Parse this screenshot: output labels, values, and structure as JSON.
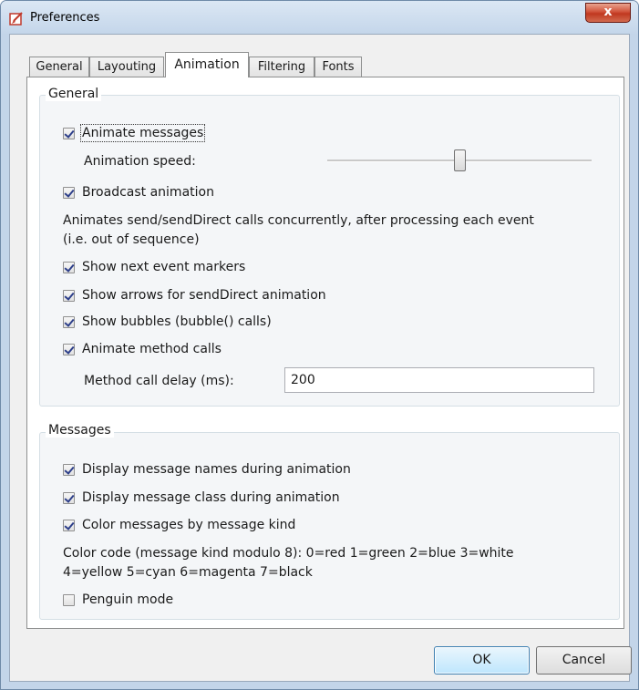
{
  "window": {
    "title": "Preferences",
    "close_glyph": "x"
  },
  "tabs": [
    {
      "label": "General"
    },
    {
      "label": "Layouting"
    },
    {
      "label": "Animation"
    },
    {
      "label": "Filtering"
    },
    {
      "label": "Fonts"
    }
  ],
  "general": {
    "title": "General",
    "animate_messages": {
      "label": "Animate messages",
      "checked": true
    },
    "animation_speed_label": "Animation speed:",
    "animation_speed_level": 0.52,
    "broadcast_animation": {
      "label": "Broadcast animation",
      "checked": true
    },
    "broadcast_description_line1": "Animates send/sendDirect calls concurrently, after processing each event",
    "broadcast_description_line2": "(i.e. out of sequence)",
    "show_next_event_markers": {
      "label": "Show next event markers",
      "checked": true
    },
    "show_arrows": {
      "label": "Show arrows for sendDirect animation",
      "checked": true
    },
    "show_bubbles": {
      "label": "Show bubbles (bubble() calls)",
      "checked": true
    },
    "animate_method_calls": {
      "label": "Animate method calls",
      "checked": true
    },
    "method_call_delay_label": "Method call delay (ms):",
    "method_call_delay_value": "200"
  },
  "messages": {
    "title": "Messages",
    "display_names": {
      "label": "Display message names during animation",
      "checked": true
    },
    "display_class": {
      "label": "Display message class during animation",
      "checked": true
    },
    "color_by_kind": {
      "label": "Color messages by message kind",
      "checked": true
    },
    "color_code_line1": "Color code (message kind modulo 8): 0=red 1=green 2=blue 3=white",
    "color_code_line2": "4=yellow 5=cyan 6=magenta 7=black",
    "penguin_mode": {
      "label": "Penguin mode",
      "checked": false
    }
  },
  "buttons": {
    "ok": "OK",
    "cancel": "Cancel"
  },
  "colors": {
    "close_button": "#c0381f",
    "checkmark": "#2d3f8a",
    "ok_button": "#bee6fd"
  }
}
